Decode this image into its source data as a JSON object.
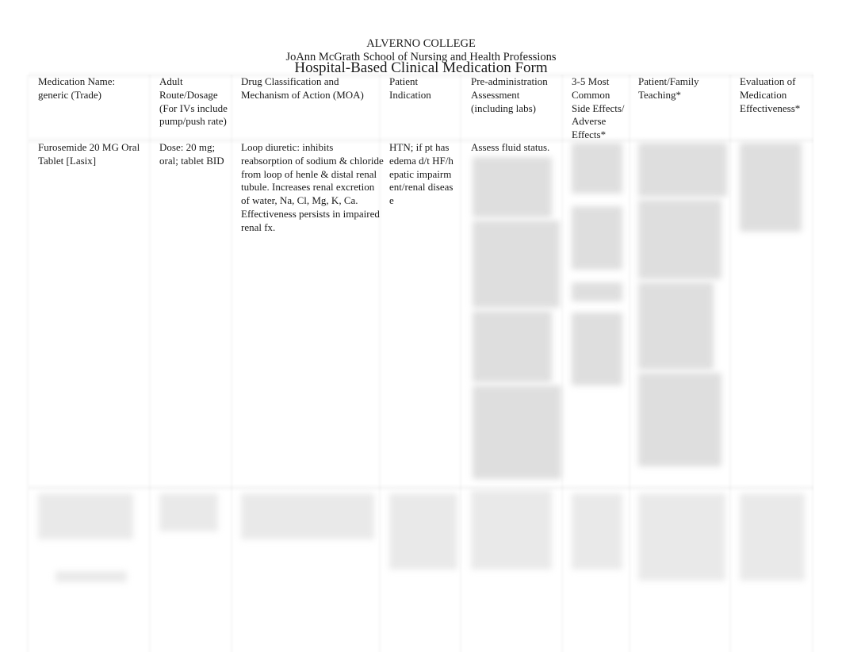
{
  "header": {
    "college": "ALVERNO COLLEGE",
    "school": "JoAnn McGrath School of Nursing and Health Professions",
    "title": "Hospital-Based Clinical Medication Form"
  },
  "table": {
    "columns": [
      {
        "label": "Medication Name: generic (Trade)"
      },
      {
        "label": "Adult Route/Dosage (For IVs include pump/push rate)"
      },
      {
        "label": "Drug Classification and Mechanism of Action (MOA)"
      },
      {
        "label": "Patient Indication"
      },
      {
        "label": "Pre-administration Assessment (including labs)"
      },
      {
        "label": "3-5 Most Common Side Effects/ Adverse Effects*"
      },
      {
        "label": "Patient/Family Teaching*"
      },
      {
        "label": "Evaluation of Medication Effectiveness*"
      }
    ],
    "rows": [
      {
        "medication": "Furosemide 20 MG Oral Tablet [Lasix]",
        "route_dosage": "Dose: 20 mg; oral; tablet BID",
        "classification_moa": "Loop diuretic: inhibits reabsorption of sodium & chloride from loop of henle & distal renal tubule. Increases renal excretion of water, Na, Cl, Mg, K, Ca. Effectiveness persists in impaired renal fx.",
        "indication": "HTN; if pt has edema d/t HF/hepatic impairment/renal disease",
        "pre_assessment": "Assess fluid status.",
        "pre_assessment_hidden": "[blurred]",
        "side_effects": "[blurred]",
        "teaching": "[blurred]",
        "evaluation": "[blurred]"
      },
      {
        "medication": "[blurred]",
        "route_dosage": "[blurred]",
        "classification_moa": "[blurred]",
        "indication": "[blurred]",
        "pre_assessment": "[blurred]",
        "side_effects": "[blurred]",
        "teaching": "[blurred]",
        "evaluation": "[blurred]"
      }
    ]
  }
}
